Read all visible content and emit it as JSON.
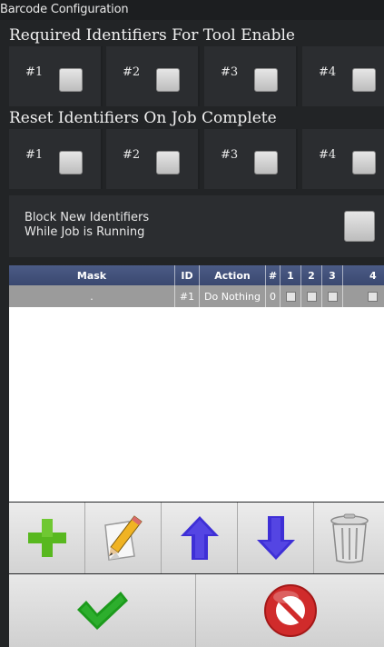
{
  "window": {
    "title": "Barcode Configuration"
  },
  "required": {
    "title": "Required Identifiers For Tool Enable",
    "items": [
      {
        "label": "#1",
        "checked": false
      },
      {
        "label": "#2",
        "checked": false
      },
      {
        "label": "#3",
        "checked": false
      },
      {
        "label": "#4",
        "checked": false
      }
    ]
  },
  "reset": {
    "title": "Reset Identifiers On Job Complete",
    "items": [
      {
        "label": "#1",
        "checked": false
      },
      {
        "label": "#2",
        "checked": false
      },
      {
        "label": "#3",
        "checked": false
      },
      {
        "label": "#4",
        "checked": false
      }
    ]
  },
  "block": {
    "line1": "Block New Identifiers",
    "line2": "While Job is Running",
    "checked": false
  },
  "grid": {
    "columns": [
      "Mask",
      "ID",
      "Action",
      "#",
      "1",
      "2",
      "3",
      "4"
    ],
    "rows": [
      {
        "mask": ".",
        "id": "#1",
        "action": "Do Nothing",
        "count": "0",
        "c1": false,
        "c2": false,
        "c3": false,
        "c4": false
      }
    ]
  },
  "toolbar": {
    "icons": [
      "add-icon",
      "edit-icon",
      "move-up-icon",
      "move-down-icon",
      "delete-icon"
    ]
  },
  "actions": {
    "icons": [
      "confirm-icon",
      "cancel-icon"
    ]
  },
  "colors": {
    "background": "#222426",
    "panel": "#2b2d30",
    "grid_header": "#3a4870",
    "grid_row": "#9b9b9b",
    "add_green": "#58b81f",
    "arrow_blue": "#3e2fd6",
    "confirm_green": "#1c9a1c",
    "cancel_red": "#d02b2b"
  }
}
